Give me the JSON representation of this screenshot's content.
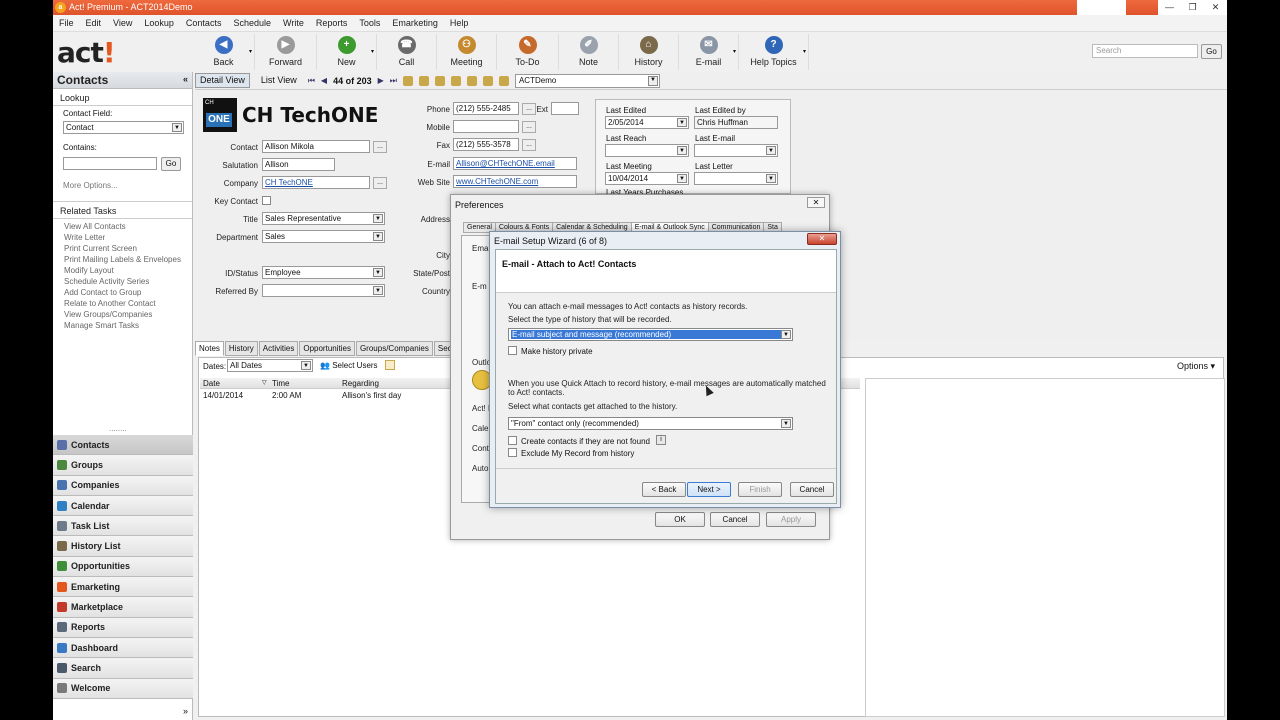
{
  "window": {
    "app_icon": "a",
    "title": "Act! Premium - ACT2014Demo",
    "min": "—",
    "max": "❐",
    "close": "✕"
  },
  "menu": [
    "File",
    "Edit",
    "View",
    "Lookup",
    "Contacts",
    "Schedule",
    "Write",
    "Reports",
    "Tools",
    "Emarketing",
    "Help"
  ],
  "logo": {
    "text": "act",
    "mark": "!"
  },
  "toolbar": [
    {
      "label": "Back",
      "icon": "back-icon",
      "glyph": "◀",
      "color": "#3a6fc4",
      "w": 62,
      "arrow": "▾"
    },
    {
      "label": "Forward",
      "icon": "forward-icon",
      "glyph": "▶",
      "color": "#9a9a9a",
      "w": 62,
      "arrow": ""
    },
    {
      "label": "New",
      "icon": "new-contact-icon",
      "glyph": "+",
      "color": "#3d9a2e",
      "w": 60,
      "arrow": "▾"
    },
    {
      "label": "Call",
      "icon": "phone-icon",
      "glyph": "☎",
      "color": "#6a6a6a",
      "w": 60,
      "arrow": ""
    },
    {
      "label": "Meeting",
      "icon": "meeting-icon",
      "glyph": "⚇",
      "color": "#c48a2d",
      "w": 60,
      "arrow": ""
    },
    {
      "label": "To-Do",
      "icon": "todo-icon",
      "glyph": "✎",
      "color": "#c56a2a",
      "w": 62,
      "arrow": ""
    },
    {
      "label": "Note",
      "icon": "note-icon",
      "glyph": "✐",
      "color": "#9aa3ad",
      "w": 60,
      "arrow": ""
    },
    {
      "label": "History",
      "icon": "history-icon",
      "glyph": "⌂",
      "color": "#7a6a4a",
      "w": 60,
      "arrow": ""
    },
    {
      "label": "E-mail",
      "icon": "email-icon",
      "glyph": "✉",
      "color": "#8a96a6",
      "w": 60,
      "arrow": "▾"
    },
    {
      "label": "Help Topics",
      "icon": "help-icon",
      "glyph": "?",
      "color": "#2f66b7",
      "w": 70,
      "arrow": "▾"
    }
  ],
  "search": {
    "placeholder": "Search",
    "go": "Go"
  },
  "left_pane": {
    "title": "Contacts",
    "collapse": "«",
    "lookup_title": "Lookup",
    "contact_field_label": "Contact Field:",
    "contact_field_value": "Contact",
    "contains_label": "Contains:",
    "go": "Go",
    "more_options": "More Options...",
    "related_tasks_title": "Related Tasks",
    "tasks": [
      "View All Contacts",
      "Write Letter",
      "Print Current Screen",
      "Print Mailing Labels & Envelopes",
      "Modify Layout",
      "Schedule Activity Series",
      "Add Contact to Group",
      "Relate to Another Contact",
      "View Groups/Companies",
      "Manage Smart Tasks"
    ],
    "grip": "........",
    "nav": [
      {
        "label": "Contacts",
        "icon": "contacts-icon",
        "color": "#5a6fa8",
        "active": true
      },
      {
        "label": "Groups",
        "icon": "groups-icon",
        "color": "#4b8a3e"
      },
      {
        "label": "Companies",
        "icon": "companies-icon",
        "color": "#4a74b0"
      },
      {
        "label": "Calendar",
        "icon": "calendar-icon",
        "color": "#2e7fc4"
      },
      {
        "label": "Task List",
        "icon": "task-list-icon",
        "color": "#6d7b8a"
      },
      {
        "label": "History List",
        "icon": "history-list-icon",
        "color": "#7a6a4a"
      },
      {
        "label": "Opportunities",
        "icon": "opportunities-icon",
        "color": "#3f8f3a"
      },
      {
        "label": "Emarketing",
        "icon": "emarketing-icon",
        "color": "#e4571e"
      },
      {
        "label": "Marketplace",
        "icon": "marketplace-icon",
        "color": "#c23a2a"
      },
      {
        "label": "Reports",
        "icon": "reports-icon",
        "color": "#5a6a7a"
      },
      {
        "label": "Dashboard",
        "icon": "dashboard-icon",
        "color": "#3a7ac4"
      },
      {
        "label": "Search",
        "icon": "search-icon",
        "color": "#4a5a6a"
      },
      {
        "label": "Welcome",
        "icon": "welcome-icon",
        "color": "#7a7a7a"
      }
    ],
    "footer_arrow": "»"
  },
  "detailbar": {
    "detail_view": "Detail View",
    "list_view": "List View",
    "first": "⏮",
    "prev": "◀",
    "count": "44 of 203",
    "next": "▶",
    "last": "⏭",
    "db": "ACTDemo"
  },
  "contact": {
    "company_logo_top": "CH",
    "company_logo_bottom": "ONE",
    "company_name": "CH TechONE",
    "contact_label": "Contact",
    "contact": "Allison Mikola",
    "salutation_label": "Salutation",
    "salutation": "Allison",
    "company_label": "Company",
    "company": "CH TechONE",
    "key_contact_label": "Key Contact",
    "title_label": "Title",
    "title": "Sales Representative",
    "department_label": "Department",
    "department": "Sales",
    "id_status_label": "ID/Status",
    "id_status": "Employee",
    "referred_by_label": "Referred By",
    "referred_by": "",
    "phone_label": "Phone",
    "phone": "(212) 555-2485",
    "ext_label": "Ext",
    "mobile_label": "Mobile",
    "mobile": "",
    "fax_label": "Fax",
    "fax": "(212) 555-3578",
    "email_label": "E-mail",
    "email": "Allison@CHTechONE.email",
    "website_label": "Web Site",
    "website": "www.CHTechONE.com",
    "address_label": "Address",
    "city_label": "City",
    "state_label": "State/Post",
    "country_label": "Country",
    "last_edited_label": "Last Edited",
    "last_edited": "2/05/2014",
    "last_edited_by_label": "Last Edited by",
    "last_edited_by": "Chris Huffman",
    "last_reach_label": "Last Reach",
    "last_email_label": "Last E-mail",
    "last_meeting_label": "Last Meeting",
    "last_meeting": "10/04/2014",
    "last_letter_label": "Last Letter",
    "last_years_label": "Last Years Purchases"
  },
  "tabs": [
    "Notes",
    "History",
    "Activities",
    "Opportunities",
    "Groups/Companies",
    "Second"
  ],
  "notes": {
    "dates_label": "Dates:",
    "dates_value": "All Dates",
    "select_users": "Select Users",
    "options": "Options ▾",
    "columns": [
      "Date",
      "Time",
      "Regarding"
    ],
    "rows": [
      {
        "date": "14/01/2014",
        "time": "2:00 AM",
        "regarding": "Allison's first day"
      }
    ]
  },
  "preferences": {
    "title": "Preferences",
    "close": "✕",
    "tabs": [
      "General",
      "Colours & Fonts",
      "Calendar & Scheduling",
      "E-mail & Outlook Sync",
      "Communication",
      "Sta"
    ],
    "active_tab": "E-mail & Outlook Sync",
    "frag_email": "Email",
    "frag_e": "E-m",
    "frag_outlook": "Outlo",
    "frag_act": "Act! D",
    "frag_calendar": "Calen",
    "frag_contacts": "Conta",
    "frag_auto": "Autor",
    "ok": "OK",
    "cancel": "Cancel",
    "apply": "Apply"
  },
  "wizard": {
    "title": "E-mail Setup Wizard (6 of 8)",
    "close": "✕",
    "heading": "E-mail - Attach to Act! Contacts",
    "text1": "You can attach e-mail messages to Act! contacts as history records.",
    "text2": "Select the type of history that will be recorded.",
    "history_type": "E-mail subject and message (recommended)",
    "private_label": "Make history private",
    "text3": "When you use Quick Attach to record history, e-mail messages are automatically matched",
    "text3b": "to Act! contacts.",
    "text4": "Select what contacts get attached to the history.",
    "attach_option": "\"From\" contact only (recommended)",
    "create_label": "Create contacts if they are not found",
    "exclude_label": "Exclude My Record from history",
    "back": "< Back",
    "next": "Next >",
    "finish": "Finish",
    "cancel": "Cancel"
  }
}
